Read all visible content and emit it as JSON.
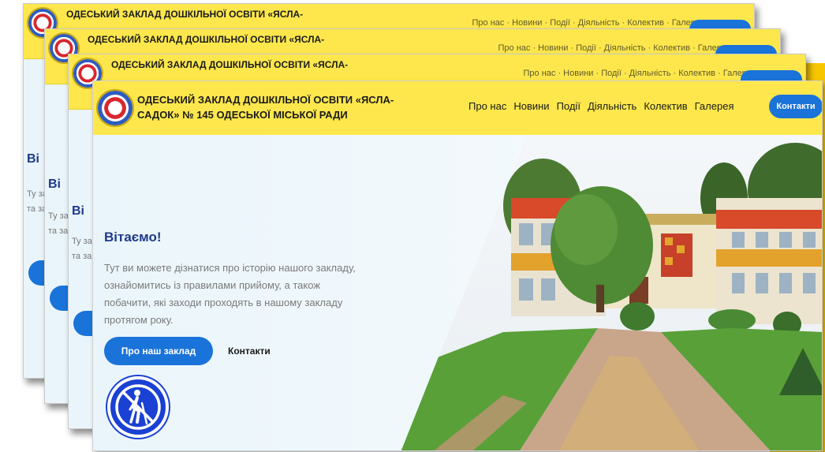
{
  "site": {
    "title": "ОДЕСЬКИЙ ЗАКЛАД ДОШКІЛЬНОЇ ОСВІТИ «ЯСЛА-САДОК» № 145 ОДЕСЬКОЇ МІСЬКОЇ РАДИ",
    "title_short": "ОДЕСЬКИЙ ЗАКЛАД ДОШКІЛЬНОЇ ОСВІТИ «ЯСЛА-"
  },
  "nav": {
    "items": [
      "Про нас",
      "Новини",
      "Події",
      "Діяльність",
      "Колектив",
      "Галерея"
    ],
    "contacts_button": "Контакти"
  },
  "hero": {
    "greeting": "Вітаємо!",
    "greeting_partial": "Ві",
    "paragraph": "Тут ви можете дізнатися про історію нашого закладу, ознайомитись із правилами прийому, а також побачити, які заходи проходять в нашому закладу протягом року.",
    "about_button": "Про наш заклад",
    "contacts_link": "Контакти"
  },
  "icons": {
    "logo": "institution-emblem-icon",
    "accessibility": "accessibility-cane-icon"
  },
  "colors": {
    "header_yellow": "#fde74c",
    "accent_blue": "#1a73d9",
    "accessibility_blue": "#1a40d4",
    "heading_blue": "#1f3a8a",
    "accent_yellow": "#f7c600"
  }
}
